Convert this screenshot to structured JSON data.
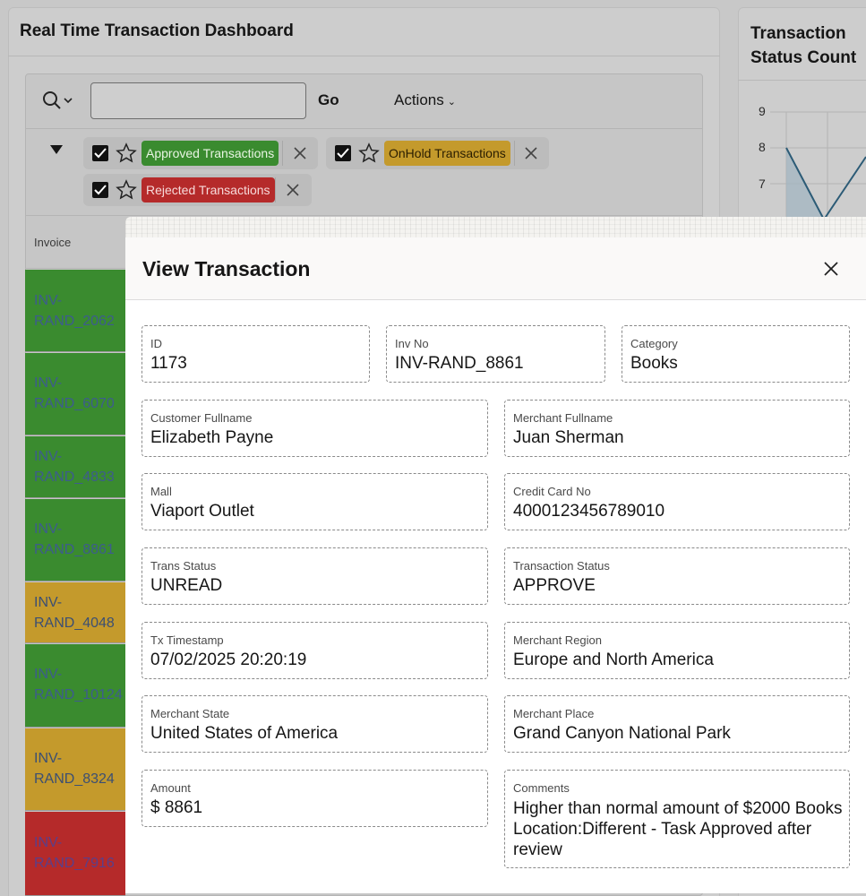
{
  "dashboard": {
    "title": "Real Time Transaction Dashboard",
    "toolbar": {
      "go_label": "Go",
      "actions_label": "Actions",
      "search_value": ""
    },
    "filters": [
      {
        "label": "Approved Transactions",
        "color": "#3a8b2f"
      },
      {
        "label": "OnHold Transactions",
        "color": "#c49a2c"
      },
      {
        "label": "Rejected Transactions",
        "color": "#b52a2a"
      }
    ],
    "column_header": "Invoice",
    "rows": [
      {
        "line1": "INV-",
        "line2": "RAND_2062",
        "status": "green"
      },
      {
        "line1": "INV-",
        "line2": "RAND_6070",
        "status": "green"
      },
      {
        "line1": "INV-",
        "line2": "RAND_4833",
        "status": "green"
      },
      {
        "line1": "INV-",
        "line2": "RAND_8861",
        "status": "green"
      },
      {
        "line1": "INV-",
        "line2": "RAND_4048",
        "status": "amber"
      },
      {
        "line1": "INV-",
        "line2": "RAND_10124",
        "status": "green"
      },
      {
        "line1": "INV-",
        "line2": "RAND_8324",
        "status": "amber"
      },
      {
        "line1": "INV-",
        "line2": "RAND_7916",
        "status": "red"
      }
    ]
  },
  "status_card": {
    "title": "Transaction Status Count",
    "y_ticks": [
      "9",
      "8",
      "7"
    ]
  },
  "modal": {
    "title": "View Transaction",
    "fields": {
      "id": {
        "label": "ID",
        "value": "1173"
      },
      "inv_no": {
        "label": "Inv No",
        "value": "INV-RAND_8861"
      },
      "category": {
        "label": "Category",
        "value": "Books"
      },
      "customer_fullname": {
        "label": "Customer Fullname",
        "value": "Elizabeth Payne"
      },
      "merchant_fullname": {
        "label": "Merchant Fullname",
        "value": "Juan Sherman"
      },
      "mall": {
        "label": "Mall",
        "value": "Viaport Outlet"
      },
      "credit_card_no": {
        "label": "Credit Card No",
        "value": "4000123456789010"
      },
      "trans_status": {
        "label": "Trans Status",
        "value": "UNREAD"
      },
      "transaction_status": {
        "label": "Transaction Status",
        "value": "APPROVE"
      },
      "tx_timestamp": {
        "label": "Tx Timestamp",
        "value": "07/02/2025 20:20:19"
      },
      "merchant_region": {
        "label": "Merchant Region",
        "value": "Europe and North America"
      },
      "merchant_state": {
        "label": "Merchant State",
        "value": "United States of America"
      },
      "merchant_place": {
        "label": "Merchant Place",
        "value": "Grand Canyon National Park"
      },
      "amount": {
        "label": "Amount",
        "value": "$ 8861"
      },
      "comments": {
        "label": "Comments",
        "value": "Higher than normal amount of $2000 Books Location:Different - Task Approved after review"
      }
    }
  },
  "colors": {
    "approved": "#3a8b2f",
    "onhold": "#c49a2c",
    "rejected": "#b52a2a"
  }
}
